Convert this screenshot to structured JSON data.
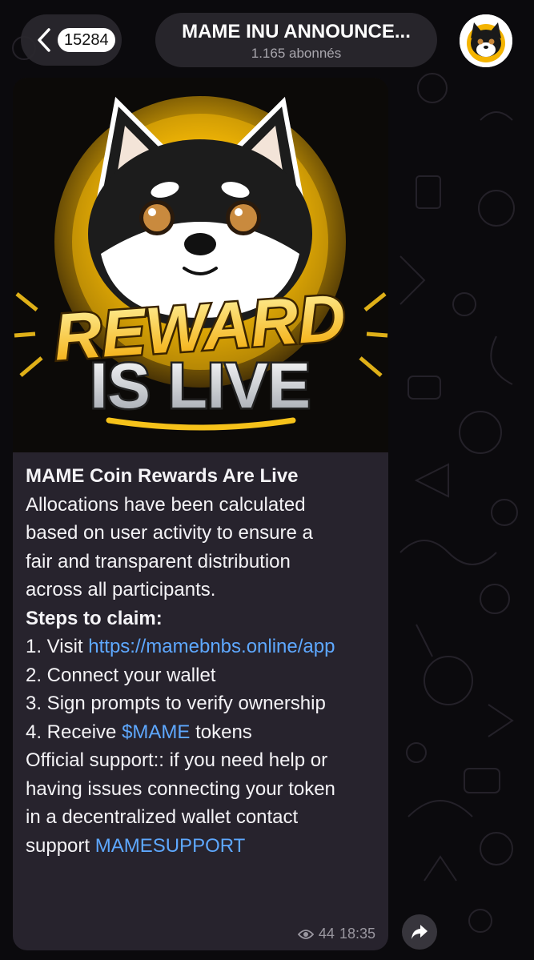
{
  "header": {
    "back_count": "15284",
    "channel_title": "MAME INU ANNOUNCE...",
    "subscribers": "1.165 abonnés"
  },
  "post": {
    "image_alt": "REWARD IS LIVE",
    "image_text": {
      "line1": "REWARD",
      "line2": "IS LIVE"
    },
    "headline": "MAME Coin Rewards Are Live",
    "para1": [
      "Allocations have been calculated",
      "based on user activity to ensure a",
      "fair and transparent distribution",
      "across all participants."
    ],
    "steps_heading": "Steps to claim:",
    "step1_prefix": "1. Visit ",
    "step1_link": "https://mamebnbs.online/app",
    "step2": "2. Connect your wallet",
    "step3": "3. Sign prompts to verify ownership",
    "step4_prefix": "4. Receive ",
    "step4_link": "$MAME",
    "step4_suffix": " tokens",
    "support": [
      "Official support:: if you need help or",
      "having issues connecting your token",
      "in a decentralized wallet contact"
    ],
    "support_last_prefix": "support ",
    "support_link": "MAMESUPPORT",
    "views": "44",
    "time": "18:35"
  },
  "colors": {
    "link": "#5ea8ff",
    "bubble": "#27232d",
    "accent_gold": "#f2b705"
  }
}
